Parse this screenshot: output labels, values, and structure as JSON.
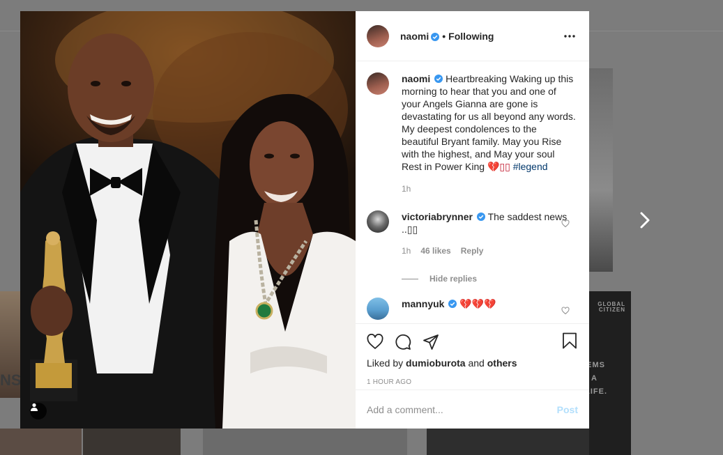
{
  "post": {
    "author": "naomi",
    "separator": "•",
    "follow_status": "Following",
    "caption": "Heartbreaking Waking up this morning to hear that you and one of your Angels Gianna are gone is devastating for us all beyond any words. My deepest condolences to the beautiful Bryant family. May you Rise with the highest, and May your soul Rest in Power King",
    "caption_emoji": "💔▯▯",
    "hashtag": "#legend",
    "caption_time": "1h",
    "liked_by_prefix": "Liked by",
    "liked_by_user": "dumioburota",
    "liked_by_and": "and",
    "liked_by_others": "others",
    "time_ago": "1 HOUR AGO"
  },
  "comments": [
    {
      "user": "victoriabrynner",
      "text": "The saddest news ..▯▯",
      "time": "1h",
      "likes": "46 likes",
      "reply": "Reply"
    },
    {
      "user": "mannyuk",
      "text": "💔💔💔"
    }
  ],
  "hide_replies": "Hide replies",
  "add_comment": {
    "placeholder": "Add a comment...",
    "post_label": "Post"
  },
  "background": {
    "tile_text_left": "NST",
    "tile_text_right": [
      "GLOBAL",
      "CITIZEN",
      "EMS",
      "A",
      "LIFE."
    ]
  },
  "colors": {
    "verified": "#3897f0",
    "link": "#00376b",
    "muted": "#8e8e8e",
    "post_disabled": "#b2dffc",
    "heart": "#c0142a"
  },
  "icons": [
    "verified-icon",
    "more-icon",
    "heart-icon",
    "comment-icon",
    "share-icon",
    "bookmark-icon",
    "user-tag-icon",
    "chevron-right-icon"
  ]
}
